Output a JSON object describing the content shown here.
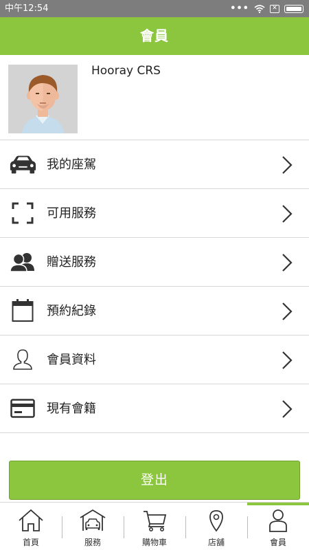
{
  "status_bar": {
    "time": "中午12:54"
  },
  "header": {
    "title": "會員"
  },
  "profile": {
    "name": "Hooray CRS"
  },
  "menu": [
    {
      "label": "我的座駕",
      "icon": "car-icon"
    },
    {
      "label": "可用服務",
      "icon": "scan-frame-icon"
    },
    {
      "label": "贈送服務",
      "icon": "people-icon"
    },
    {
      "label": "預約紀錄",
      "icon": "calendar-icon"
    },
    {
      "label": "會員資料",
      "icon": "person-outline-icon"
    },
    {
      "label": "現有會籍",
      "icon": "credit-card-icon"
    }
  ],
  "logout_label": "登出",
  "nav": [
    {
      "label": "首頁",
      "icon": "home-icon"
    },
    {
      "label": "服務",
      "icon": "garage-car-icon"
    },
    {
      "label": "購物車",
      "icon": "cart-icon"
    },
    {
      "label": "店舖",
      "icon": "location-pin-icon"
    },
    {
      "label": "會員",
      "icon": "member-icon",
      "active": true
    }
  ],
  "colors": {
    "accent": "#8cc63f",
    "status_bar": "#7d7d7d"
  }
}
